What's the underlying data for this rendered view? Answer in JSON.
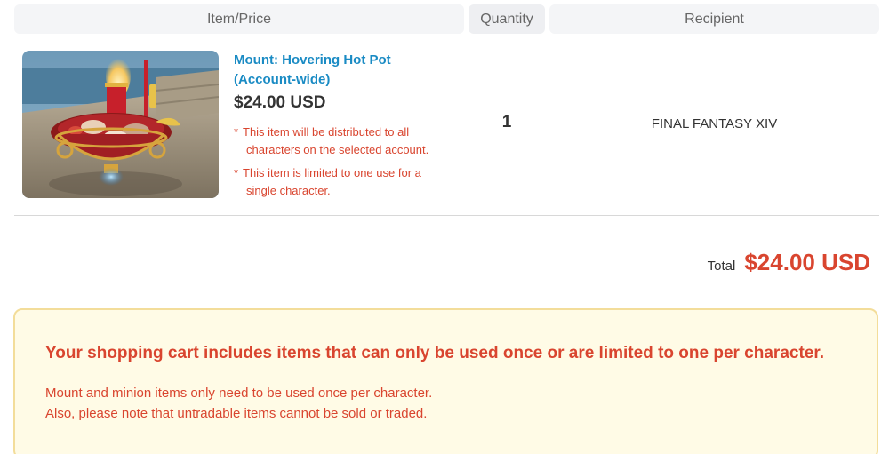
{
  "header": {
    "item_price": "Item/Price",
    "quantity": "Quantity",
    "recipient": "Recipient"
  },
  "item": {
    "image_alt": "Hovering Hot Pot mount",
    "name": "Mount: Hovering Hot Pot (Account-wide)",
    "price": "$24.00 USD",
    "notes": [
      "This item will be distributed to all characters on the selected account.",
      "This item is limited to one use for a single character."
    ],
    "note_marker": "*",
    "quantity": "1",
    "recipient": "FINAL FANTASY XIV"
  },
  "total": {
    "label": "Total",
    "value": "$24.00 USD"
  },
  "notice": {
    "title": "Your shopping cart includes items that can only be used once or are limited to one per character.",
    "line1": "Mount and minion items only need to be used once per character.",
    "line2": "Also, please note that untradable items cannot be sold or traded."
  },
  "colors": {
    "link_blue": "#1a8bc4",
    "alert_red": "#d9452f",
    "notice_bg": "#fffbe6",
    "notice_border": "#f3dd9a",
    "header_bg": "#f4f5f7"
  }
}
